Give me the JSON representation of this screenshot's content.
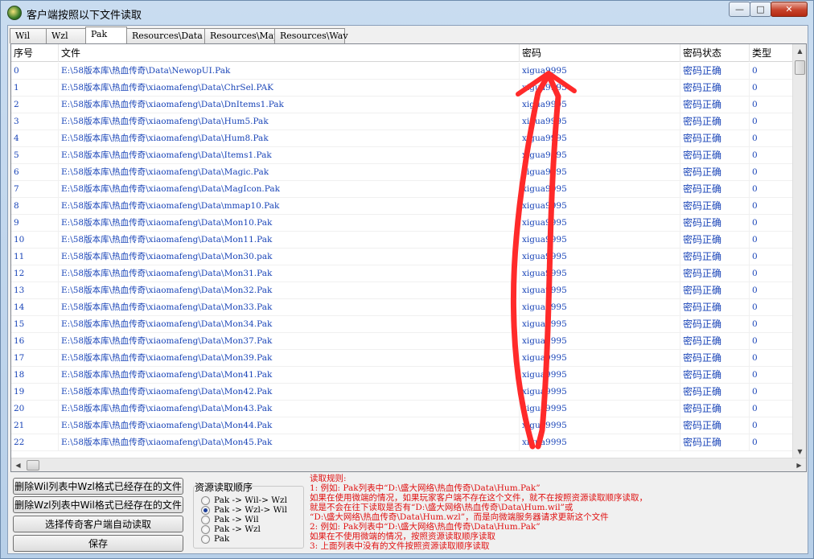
{
  "window": {
    "title": "客户端按照以下文件读取"
  },
  "tabs": [
    {
      "label": "Wil"
    },
    {
      "label": "Wzl"
    },
    {
      "label": "Pak"
    },
    {
      "label": "Resources\\Data"
    },
    {
      "label": "Resources\\Map"
    },
    {
      "label": "Resources\\Wav"
    }
  ],
  "columns": [
    "序号",
    "文件",
    "密码",
    "密码状态",
    "类型"
  ],
  "rows": [
    {
      "idx": "0",
      "file": "E:\\58版本库\\热血传奇\\Data\\NewopUI.Pak",
      "pwd": "xigua9995",
      "status": "密码正确",
      "type": "0"
    },
    {
      "idx": "1",
      "file": "E:\\58版本库\\热血传奇\\xiaomafeng\\Data\\ChrSel.PAK",
      "pwd": "xigua9995",
      "status": "密码正确",
      "type": "0"
    },
    {
      "idx": "2",
      "file": "E:\\58版本库\\热血传奇\\xiaomafeng\\Data\\DnItems1.Pak",
      "pwd": "xigua9995",
      "status": "密码正确",
      "type": "0"
    },
    {
      "idx": "3",
      "file": "E:\\58版本库\\热血传奇\\xiaomafeng\\Data\\Hum5.Pak",
      "pwd": "xigua9995",
      "status": "密码正确",
      "type": "0"
    },
    {
      "idx": "4",
      "file": "E:\\58版本库\\热血传奇\\xiaomafeng\\Data\\Hum8.Pak",
      "pwd": "xigua9995",
      "status": "密码正确",
      "type": "0"
    },
    {
      "idx": "5",
      "file": "E:\\58版本库\\热血传奇\\xiaomafeng\\Data\\Items1.Pak",
      "pwd": "xigua9995",
      "status": "密码正确",
      "type": "0"
    },
    {
      "idx": "6",
      "file": "E:\\58版本库\\热血传奇\\xiaomafeng\\Data\\Magic.Pak",
      "pwd": "xigua9995",
      "status": "密码正确",
      "type": "0"
    },
    {
      "idx": "7",
      "file": "E:\\58版本库\\热血传奇\\xiaomafeng\\Data\\MagIcon.Pak",
      "pwd": "xigua9995",
      "status": "密码正确",
      "type": "0"
    },
    {
      "idx": "8",
      "file": "E:\\58版本库\\热血传奇\\xiaomafeng\\Data\\mmap10.Pak",
      "pwd": "xigua9995",
      "status": "密码正确",
      "type": "0"
    },
    {
      "idx": "9",
      "file": "E:\\58版本库\\热血传奇\\xiaomafeng\\Data\\Mon10.Pak",
      "pwd": "xigua9995",
      "status": "密码正确",
      "type": "0"
    },
    {
      "idx": "10",
      "file": "E:\\58版本库\\热血传奇\\xiaomafeng\\Data\\Mon11.Pak",
      "pwd": "xigua9995",
      "status": "密码正确",
      "type": "0"
    },
    {
      "idx": "11",
      "file": "E:\\58版本库\\热血传奇\\xiaomafeng\\Data\\Mon30.pak",
      "pwd": "xigua9995",
      "status": "密码正确",
      "type": "0"
    },
    {
      "idx": "12",
      "file": "E:\\58版本库\\热血传奇\\xiaomafeng\\Data\\Mon31.Pak",
      "pwd": "xigua9995",
      "status": "密码正确",
      "type": "0"
    },
    {
      "idx": "13",
      "file": "E:\\58版本库\\热血传奇\\xiaomafeng\\Data\\Mon32.Pak",
      "pwd": "xigua9995",
      "status": "密码正确",
      "type": "0"
    },
    {
      "idx": "14",
      "file": "E:\\58版本库\\热血传奇\\xiaomafeng\\Data\\Mon33.Pak",
      "pwd": "xigua9995",
      "status": "密码正确",
      "type": "0"
    },
    {
      "idx": "15",
      "file": "E:\\58版本库\\热血传奇\\xiaomafeng\\Data\\Mon34.Pak",
      "pwd": "xigua9995",
      "status": "密码正确",
      "type": "0"
    },
    {
      "idx": "16",
      "file": "E:\\58版本库\\热血传奇\\xiaomafeng\\Data\\Mon37.Pak",
      "pwd": "xigua9995",
      "status": "密码正确",
      "type": "0"
    },
    {
      "idx": "17",
      "file": "E:\\58版本库\\热血传奇\\xiaomafeng\\Data\\Mon39.Pak",
      "pwd": "xigua9995",
      "status": "密码正确",
      "type": "0"
    },
    {
      "idx": "18",
      "file": "E:\\58版本库\\热血传奇\\xiaomafeng\\Data\\Mon41.Pak",
      "pwd": "xigua9995",
      "status": "密码正确",
      "type": "0"
    },
    {
      "idx": "19",
      "file": "E:\\58版本库\\热血传奇\\xiaomafeng\\Data\\Mon42.Pak",
      "pwd": "xigua9995",
      "status": "密码正确",
      "type": "0"
    },
    {
      "idx": "20",
      "file": "E:\\58版本库\\热血传奇\\xiaomafeng\\Data\\Mon43.Pak",
      "pwd": "xigua9995",
      "status": "密码正确",
      "type": "0"
    },
    {
      "idx": "21",
      "file": "E:\\58版本库\\热血传奇\\xiaomafeng\\Data\\Mon44.Pak",
      "pwd": "xigua9995",
      "status": "密码正确",
      "type": "0"
    },
    {
      "idx": "22",
      "file": "E:\\58版本库\\热血传奇\\xiaomafeng\\Data\\Mon45.Pak",
      "pwd": "xigua9995",
      "status": "密码正确",
      "type": "0"
    }
  ],
  "buttons": {
    "del_wil": "删除Wil列表中Wzl格式已经存在的文件",
    "del_wzl": "删除Wzl列表中Wil格式已经存在的文件",
    "choose_client": "选择传奇客户端自动读取",
    "save": "保存"
  },
  "order_group": {
    "title": "资源读取顺序",
    "options": [
      "Pak -> Wil-> Wzl",
      "Pak -> Wzl-> Wil",
      "Pak -> Wil",
      "Pak -> Wzl",
      "Pak"
    ],
    "selected": 1
  },
  "rules": [
    "读取规则:",
    "1: 例如: Pak列表中“D:\\盛大网络\\热血传奇\\Data\\Hum.Pak”",
    "    如果在使用微端的情况，如果玩家客户端不存在这个文件，就不在按照资源读取顺序读取，",
    "    就是不会在往下读取是否有“D:\\盛大网络\\热血传奇\\Data\\Hum.wil”或",
    "    “D:\\盛大网络\\热血传奇\\Data\\Hum.wzl”，而是向微端服务器请求更新这个文件",
    "2: 例如: Pak列表中“D:\\盛大网络\\热血传奇\\Data\\Hum.Pak”",
    "    如果在不使用微端的情况，按照资源读取顺序读取",
    "3: 上面列表中没有的文件按照资源读取顺序读取"
  ],
  "colors": {
    "link_blue": "#1a45b8",
    "rule_red": "#e01010",
    "annotation_red": "#ff2a2a"
  }
}
